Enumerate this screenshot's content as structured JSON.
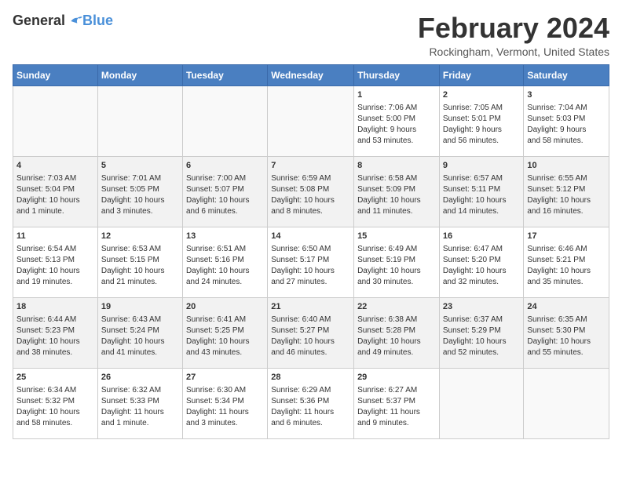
{
  "header": {
    "logo_general": "General",
    "logo_blue": "Blue",
    "month_title": "February 2024",
    "location": "Rockingham, Vermont, United States"
  },
  "weekdays": [
    "Sunday",
    "Monday",
    "Tuesday",
    "Wednesday",
    "Thursday",
    "Friday",
    "Saturday"
  ],
  "weeks": [
    [
      {
        "day": "",
        "content": ""
      },
      {
        "day": "",
        "content": ""
      },
      {
        "day": "",
        "content": ""
      },
      {
        "day": "",
        "content": ""
      },
      {
        "day": "1",
        "content": "Sunrise: 7:06 AM\nSunset: 5:00 PM\nDaylight: 9 hours\nand 53 minutes."
      },
      {
        "day": "2",
        "content": "Sunrise: 7:05 AM\nSunset: 5:01 PM\nDaylight: 9 hours\nand 56 minutes."
      },
      {
        "day": "3",
        "content": "Sunrise: 7:04 AM\nSunset: 5:03 PM\nDaylight: 9 hours\nand 58 minutes."
      }
    ],
    [
      {
        "day": "4",
        "content": "Sunrise: 7:03 AM\nSunset: 5:04 PM\nDaylight: 10 hours\nand 1 minute."
      },
      {
        "day": "5",
        "content": "Sunrise: 7:01 AM\nSunset: 5:05 PM\nDaylight: 10 hours\nand 3 minutes."
      },
      {
        "day": "6",
        "content": "Sunrise: 7:00 AM\nSunset: 5:07 PM\nDaylight: 10 hours\nand 6 minutes."
      },
      {
        "day": "7",
        "content": "Sunrise: 6:59 AM\nSunset: 5:08 PM\nDaylight: 10 hours\nand 8 minutes."
      },
      {
        "day": "8",
        "content": "Sunrise: 6:58 AM\nSunset: 5:09 PM\nDaylight: 10 hours\nand 11 minutes."
      },
      {
        "day": "9",
        "content": "Sunrise: 6:57 AM\nSunset: 5:11 PM\nDaylight: 10 hours\nand 14 minutes."
      },
      {
        "day": "10",
        "content": "Sunrise: 6:55 AM\nSunset: 5:12 PM\nDaylight: 10 hours\nand 16 minutes."
      }
    ],
    [
      {
        "day": "11",
        "content": "Sunrise: 6:54 AM\nSunset: 5:13 PM\nDaylight: 10 hours\nand 19 minutes."
      },
      {
        "day": "12",
        "content": "Sunrise: 6:53 AM\nSunset: 5:15 PM\nDaylight: 10 hours\nand 21 minutes."
      },
      {
        "day": "13",
        "content": "Sunrise: 6:51 AM\nSunset: 5:16 PM\nDaylight: 10 hours\nand 24 minutes."
      },
      {
        "day": "14",
        "content": "Sunrise: 6:50 AM\nSunset: 5:17 PM\nDaylight: 10 hours\nand 27 minutes."
      },
      {
        "day": "15",
        "content": "Sunrise: 6:49 AM\nSunset: 5:19 PM\nDaylight: 10 hours\nand 30 minutes."
      },
      {
        "day": "16",
        "content": "Sunrise: 6:47 AM\nSunset: 5:20 PM\nDaylight: 10 hours\nand 32 minutes."
      },
      {
        "day": "17",
        "content": "Sunrise: 6:46 AM\nSunset: 5:21 PM\nDaylight: 10 hours\nand 35 minutes."
      }
    ],
    [
      {
        "day": "18",
        "content": "Sunrise: 6:44 AM\nSunset: 5:23 PM\nDaylight: 10 hours\nand 38 minutes."
      },
      {
        "day": "19",
        "content": "Sunrise: 6:43 AM\nSunset: 5:24 PM\nDaylight: 10 hours\nand 41 minutes."
      },
      {
        "day": "20",
        "content": "Sunrise: 6:41 AM\nSunset: 5:25 PM\nDaylight: 10 hours\nand 43 minutes."
      },
      {
        "day": "21",
        "content": "Sunrise: 6:40 AM\nSunset: 5:27 PM\nDaylight: 10 hours\nand 46 minutes."
      },
      {
        "day": "22",
        "content": "Sunrise: 6:38 AM\nSunset: 5:28 PM\nDaylight: 10 hours\nand 49 minutes."
      },
      {
        "day": "23",
        "content": "Sunrise: 6:37 AM\nSunset: 5:29 PM\nDaylight: 10 hours\nand 52 minutes."
      },
      {
        "day": "24",
        "content": "Sunrise: 6:35 AM\nSunset: 5:30 PM\nDaylight: 10 hours\nand 55 minutes."
      }
    ],
    [
      {
        "day": "25",
        "content": "Sunrise: 6:34 AM\nSunset: 5:32 PM\nDaylight: 10 hours\nand 58 minutes."
      },
      {
        "day": "26",
        "content": "Sunrise: 6:32 AM\nSunset: 5:33 PM\nDaylight: 11 hours\nand 1 minute."
      },
      {
        "day": "27",
        "content": "Sunrise: 6:30 AM\nSunset: 5:34 PM\nDaylight: 11 hours\nand 3 minutes."
      },
      {
        "day": "28",
        "content": "Sunrise: 6:29 AM\nSunset: 5:36 PM\nDaylight: 11 hours\nand 6 minutes."
      },
      {
        "day": "29",
        "content": "Sunrise: 6:27 AM\nSunset: 5:37 PM\nDaylight: 11 hours\nand 9 minutes."
      },
      {
        "day": "",
        "content": ""
      },
      {
        "day": "",
        "content": ""
      }
    ]
  ]
}
